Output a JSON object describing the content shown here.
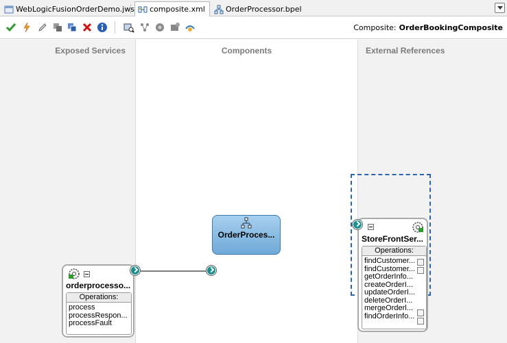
{
  "tabs": [
    {
      "label": "WebLogicFusionOrderDemo.jws",
      "icon": "workspace-icon",
      "active": false
    },
    {
      "label": "composite.xml",
      "icon": "composite-icon",
      "active": true
    },
    {
      "label": "OrderProcessor.bpel",
      "icon": "bpel-icon",
      "active": false
    }
  ],
  "toolbar": {
    "composite_label": "Composite:",
    "composite_name": "OrderBookingComposite"
  },
  "swimlanes": {
    "exposed": "Exposed Services",
    "components": "Components",
    "external": "External References"
  },
  "exposed_service": {
    "title": "orderprocesso...",
    "operations_header": "Operations:",
    "operations": [
      "process",
      "processRespon...",
      "processFault"
    ]
  },
  "component": {
    "title": "OrderProces..."
  },
  "external_reference": {
    "title": "StoreFrontSer...",
    "operations_header": "Operations:",
    "operations": [
      "findCustomer...",
      "findCustomer...",
      "getOrderInfo...",
      "createOrderI...",
      "updateOrderI...",
      "deleteOrderI...",
      "mergeOrderl...",
      "findOrderInfo..."
    ]
  },
  "colors": {
    "accent": "#1a8e8e",
    "component_fill": "#8dbfe6",
    "selection": "#2b63b3"
  }
}
